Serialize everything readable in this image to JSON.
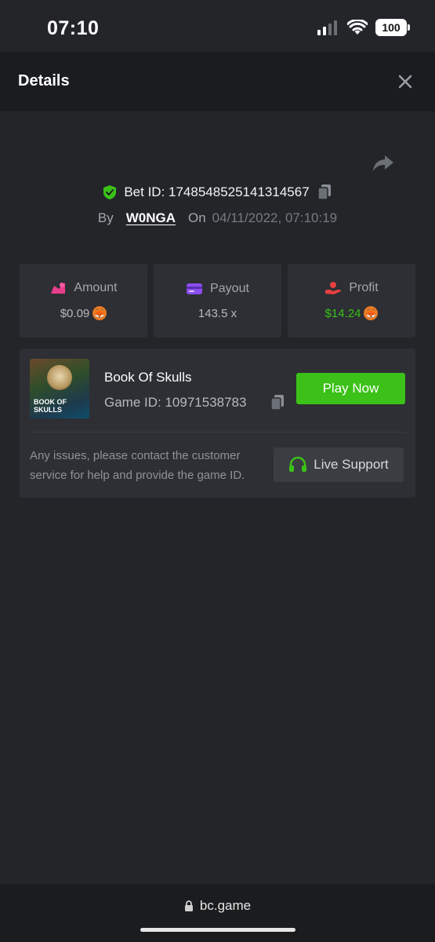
{
  "status_bar": {
    "time": "07:10",
    "battery": "100"
  },
  "header": {
    "title": "Details"
  },
  "bet": {
    "id_label": "Bet ID: 1748548525141314567",
    "by_label": "By",
    "username": "W0NGA",
    "on_label": "On",
    "date": "04/11/2022, 07:10:19"
  },
  "stats": {
    "amount": {
      "label": "Amount",
      "value": "$0.09"
    },
    "payout": {
      "label": "Payout",
      "value": "143.5 x"
    },
    "profit": {
      "label": "Profit",
      "value": "$14.24"
    }
  },
  "game": {
    "thumb_text_1": "BOOK OF",
    "thumb_text_2": "SKULLS",
    "title": "Book Of Skulls",
    "id_label": "Game ID: 10971538783",
    "play_label": "Play Now",
    "support_text": "Any issues, please contact the customer service for help and provide the game ID.",
    "support_label": "Live Support"
  },
  "browser": {
    "url": "bc.game"
  },
  "colors": {
    "accent_green": "#3bc117",
    "bg": "#232529",
    "panel": "#2d2f34",
    "amount_icon": "#e83e8c",
    "payout_icon": "#8c4df0",
    "profit_icon": "#e84040"
  }
}
